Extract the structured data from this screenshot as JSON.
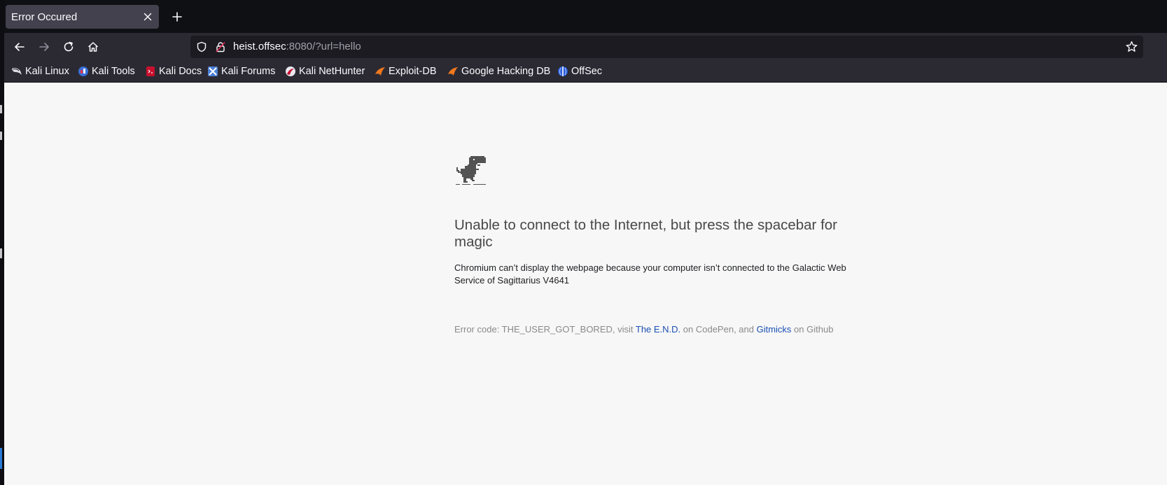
{
  "tab": {
    "title": "Error Occured",
    "close_icon": "close-icon"
  },
  "new_tab_icon": "plus-icon",
  "nav": {
    "back_icon": "arrow-left-icon",
    "forward_icon": "arrow-right-icon",
    "reload_icon": "reload-icon",
    "home_icon": "home-icon"
  },
  "urlbar": {
    "host": "heist.offsec",
    "rest": ":8080/?url=hello",
    "shield_icon": "shield-icon",
    "lock_icon": "insecure-lock-icon",
    "star_icon": "star-icon"
  },
  "bookmarks": [
    {
      "label": "Kali Linux",
      "icon": "kali-dragon-icon"
    },
    {
      "label": "Kali Tools",
      "icon": "kali-tools-icon"
    },
    {
      "label": "Kali Docs",
      "icon": "kali-docs-icon"
    },
    {
      "label": "Kali Forums",
      "icon": "kali-forums-icon"
    },
    {
      "label": "Kali NetHunter",
      "icon": "nethunter-icon"
    },
    {
      "label": "Exploit-DB",
      "icon": "exploit-db-icon"
    },
    {
      "label": "Google Hacking DB",
      "icon": "ghdb-icon"
    },
    {
      "label": "OffSec",
      "icon": "offsec-icon"
    }
  ],
  "page": {
    "heading": "Unable to connect to the Internet, but press the spacebar for magic",
    "description": "Chromium can’t display the webpage because your computer isn’t connected to the Galactic Web Service of Sagittarius V4641",
    "error_prefix": "Error code: THE_USER_GOT_BORED, visit ",
    "link1": "The E.N.D.",
    "error_mid": " on CodePen, and ",
    "link2": "Gitmicks",
    "error_suffix": " on Github",
    "dino_icon": "dinosaur-icon"
  },
  "colors": {
    "link": "#1a4fb3",
    "page_bg": "#f7f7f7",
    "toolbar_bg": "#2b2a33",
    "tabbar_bg": "#0f1014"
  }
}
